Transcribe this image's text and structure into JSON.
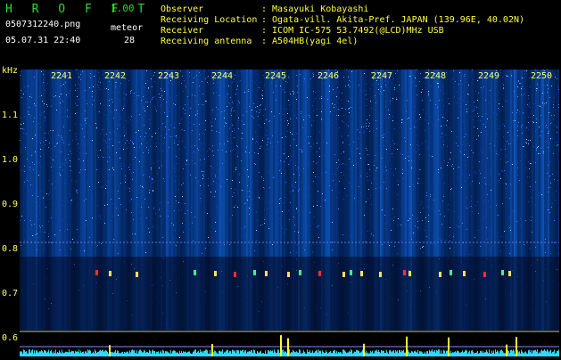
{
  "header": {
    "app_title": "H R O F F T",
    "version": "1.00",
    "filename": "0507312240.png",
    "datetime": "05.07.31 22:40",
    "meteor_label": "meteor",
    "meteor_count": "28",
    "info": [
      {
        "key": "Observer",
        "value": ": Masayuki Kobayashi"
      },
      {
        "key": "Receiving Location",
        "value": ": Ogata-vill. Akita-Pref. JAPAN (139.96E, 40.02N)"
      },
      {
        "key": "Receiver",
        "value": ": ICOM IC-575 53.7492(@LCD)MHz USB"
      },
      {
        "key": "Receiving antenna",
        "value": ": A504HB(yagi 4el)"
      }
    ]
  },
  "axis": {
    "y_unit": "kHz",
    "y_ticks": [
      "1.1",
      "1.0",
      "0.9",
      "0.8",
      "0.7",
      "0.6"
    ],
    "x_ticks": [
      "2241",
      "2242",
      "2243",
      "2244",
      "2245",
      "2246",
      "2247",
      "2248",
      "2249",
      "2250"
    ]
  },
  "colors": {
    "title_green": "#2fd82f",
    "label_yellow": "#ffff40",
    "spectrum_blue": "#1f52e0",
    "marker_red": "#ff3030"
  }
}
